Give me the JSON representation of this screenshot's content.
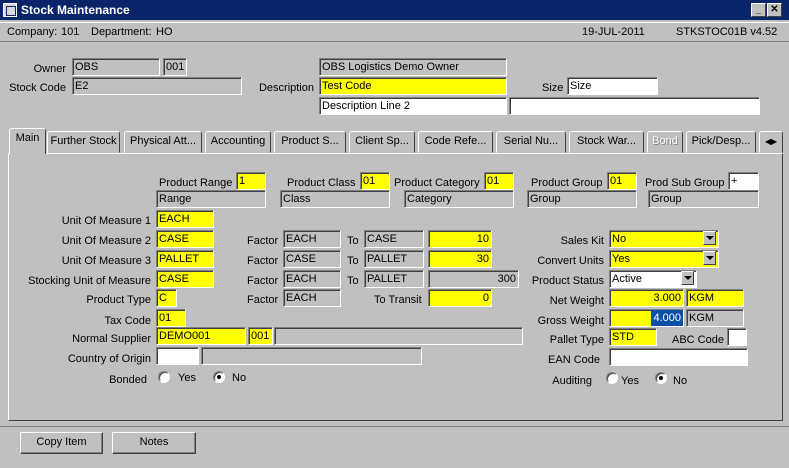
{
  "window": {
    "title": "Stock Maintenance"
  },
  "info": {
    "company_label": "Company:",
    "company": "101",
    "department_label": "Department:",
    "department": "HO",
    "date": "19-JUL-2011",
    "form_id": "STKSTOC01B v4.52"
  },
  "header": {
    "owner_label": "Owner",
    "owner_code": "OBS",
    "owner_num": "001",
    "stock_code_label": "Stock Code",
    "stock_code": "E2",
    "owner_desc": "OBS Logistics Demo Owner",
    "description_label": "Description",
    "description": "Test Code",
    "description_line2": "Description Line 2",
    "size_label": "Size",
    "size": "Size"
  },
  "tabs": [
    "Main",
    "Further Stock",
    "Physical Att...",
    "Accounting",
    "Product S...",
    "Client Sp...",
    "Code Refe...",
    "Serial Nu...",
    "Stock War...",
    "Bond",
    "Pick/Desp..."
  ],
  "groups": {
    "product_range_label": "Product Range",
    "product_range": "1",
    "product_range_desc": "Range",
    "product_class_label": "Product Class",
    "product_class": "01",
    "product_class_desc": "Class",
    "product_category_label": "Product Category",
    "product_category": "01",
    "product_category_desc": "Category",
    "product_group_label": "Product Group",
    "product_group": "01",
    "product_group_desc": "Group",
    "prod_sub_group_label": "Prod Sub Group",
    "prod_sub_group": "+",
    "prod_sub_group_desc": "Group"
  },
  "uom": {
    "uom1_label": "Unit Of Measure 1",
    "uom1": "EACH",
    "uom2_label": "Unit Of Measure 2",
    "uom2": "CASE",
    "uom3_label": "Unit Of Measure 3",
    "uom3": "PALLET",
    "stocking_label": "Stocking Unit of Measure",
    "stocking": "CASE",
    "factor_label": "Factor",
    "to_label": "To",
    "f2_from": "EACH",
    "f2_to": "CASE",
    "f2_value": "10",
    "f3_from": "CASE",
    "f3_to": "PALLET",
    "f3_value": "30",
    "f4_from": "EACH",
    "f4_to": "PALLET",
    "f4_value": "300",
    "f5_from": "EACH",
    "to_transit_label": "To Transit",
    "to_transit": "0"
  },
  "left": {
    "product_type_label": "Product Type",
    "product_type": "C",
    "tax_code_label": "Tax Code",
    "tax_code": "01",
    "normal_supplier_label": "Normal Supplier",
    "normal_supplier": "DEMO001",
    "normal_supplier_num": "001",
    "country_label": "Country of Origin",
    "bonded_label": "Bonded",
    "yes": "Yes",
    "no": "No"
  },
  "right": {
    "sales_kit_label": "Sales Kit",
    "sales_kit": "No",
    "convert_units_label": "Convert Units",
    "convert_units": "Yes",
    "product_status_label": "Product Status",
    "product_status": "Active",
    "net_weight_label": "Net Weight",
    "net_weight": "3.000",
    "net_unit": "KGM",
    "gross_weight_label": "Gross Weight",
    "gross_weight": "4.000",
    "gross_unit": "KGM",
    "pallet_type_label": "Pallet Type",
    "pallet_type": "STD",
    "abc_code_label": "ABC Code",
    "ean_code_label": "EAN Code",
    "auditing_label": "Auditing",
    "yes": "Yes",
    "no": "No"
  },
  "buttons": {
    "copy_item": "Copy Item",
    "notes": "Notes"
  }
}
